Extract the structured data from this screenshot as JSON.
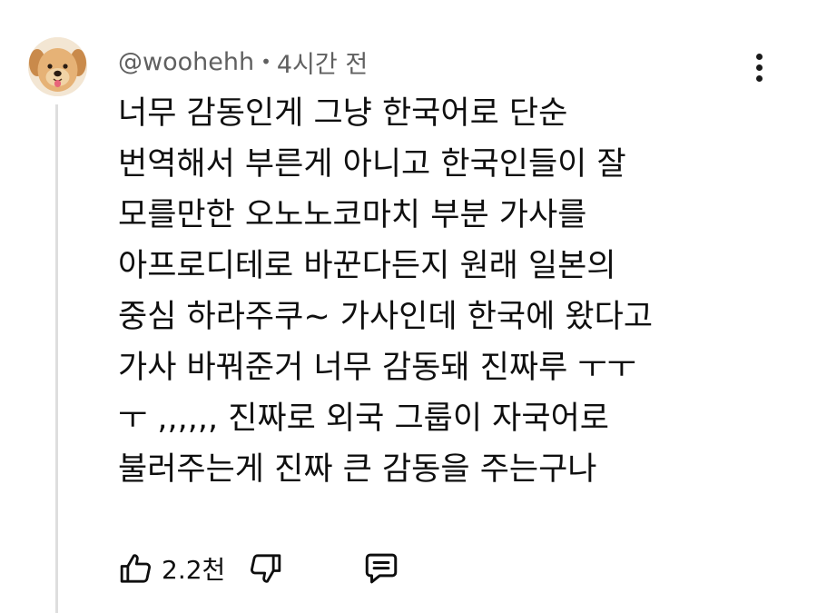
{
  "comment": {
    "author": "@woohehh",
    "separator": "•",
    "timestamp": "4시간 전",
    "lines": [
      "너무 감동인게 그냥 한국어로 단순",
      "번역해서 부른게 아니고 한국인들이 잘",
      "모를만한 오노노코마치 부분 가사를",
      "아프로디테로 바꾼다든지 원래 일본의",
      "중심 하라주쿠~ 가사인데 한국에 왔다고",
      "가사 바꿔준거 너무 감동돼 진짜루 ㅜㅜ",
      "ㅜ ,,,,,, 진짜로 외국 그룹이 자국어로",
      "불러주는게 진짜 큰 감동을 주는구나"
    ]
  },
  "actions": {
    "like_count": "2.2천",
    "icons": [
      "like-icon",
      "dislike-icon",
      "reply-icon",
      "more-vertical-icon"
    ]
  },
  "colors": {
    "text": "#0f0f0f",
    "meta_text": "#606060",
    "thread_line": "#dedede",
    "background": "#ffffff"
  }
}
